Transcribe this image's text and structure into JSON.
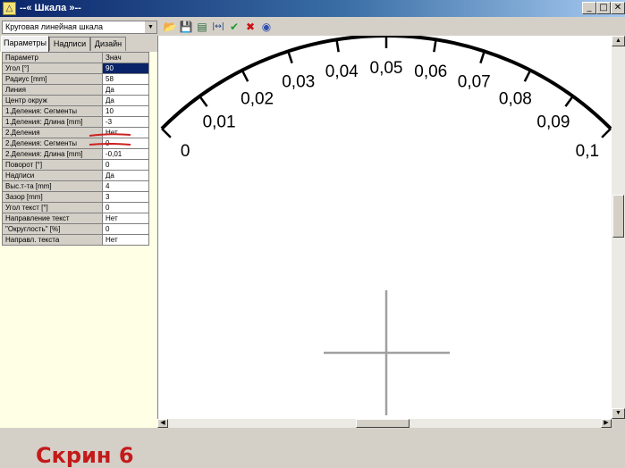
{
  "window": {
    "title": "--« Шкала »--",
    "icon": "triangle-app-icon"
  },
  "toolbar": {
    "combo_value": "Круговая линейная шкала",
    "buttons": [
      "open-folder-icon",
      "save-icon",
      "save-as-icon",
      "fit-width-icon",
      "check-icon",
      "delete-x-icon",
      "help-icon"
    ]
  },
  "tabs": [
    {
      "label": "Параметры",
      "active": true
    },
    {
      "label": "Надписи",
      "active": false
    },
    {
      "label": "Дизайн",
      "active": false
    }
  ],
  "grid": {
    "header": {
      "name": "Параметр",
      "value": "Знач"
    },
    "rows": [
      {
        "name": "Угол         [°]",
        "value": "90",
        "selected": true
      },
      {
        "name": "Радиус [mm]",
        "value": "58"
      },
      {
        "name": "Линия",
        "value": "Да"
      },
      {
        "name": "Центр окруж",
        "value": "Да"
      },
      {
        "name": "1.Деления: Сегменты",
        "value": "10"
      },
      {
        "name": "1.Деления: Длина [mm]",
        "value": "-3"
      },
      {
        "name": "2.Деления",
        "value": "Нет"
      },
      {
        "name": "2.Деления: Сегменты",
        "value": "0"
      },
      {
        "name": "2.Деления: Длина [mm]",
        "value": "-0,01"
      },
      {
        "name": "Поворот [°]",
        "value": "0"
      },
      {
        "name": "Надписи",
        "value": "Да"
      },
      {
        "name": "Выс.т-та [mm]",
        "value": "4"
      },
      {
        "name": "Зазор   [mm]",
        "value": "3"
      },
      {
        "name": "Угол текст [°]",
        "value": "0"
      },
      {
        "name": "Направление текст",
        "value": "Нет"
      },
      {
        "name": "\"Округлость\" [%]",
        "value": "0"
      },
      {
        "name": "Направл. текста",
        "value": "Нет"
      }
    ]
  },
  "screen_label": "Скрин 6",
  "scale": {
    "labels": [
      "0",
      "0,01",
      "0,02",
      "0,03",
      "0,04",
      "0,05",
      "0,06",
      "0,07",
      "0,08",
      "0,09",
      "0,1"
    ],
    "angle_deg": 90,
    "divisions": 10
  },
  "colors": {
    "annotation_red": "#cc2222",
    "selection": "#0a246a",
    "panel_bg": "#ffffe6",
    "label_red": "#c41a1a"
  }
}
